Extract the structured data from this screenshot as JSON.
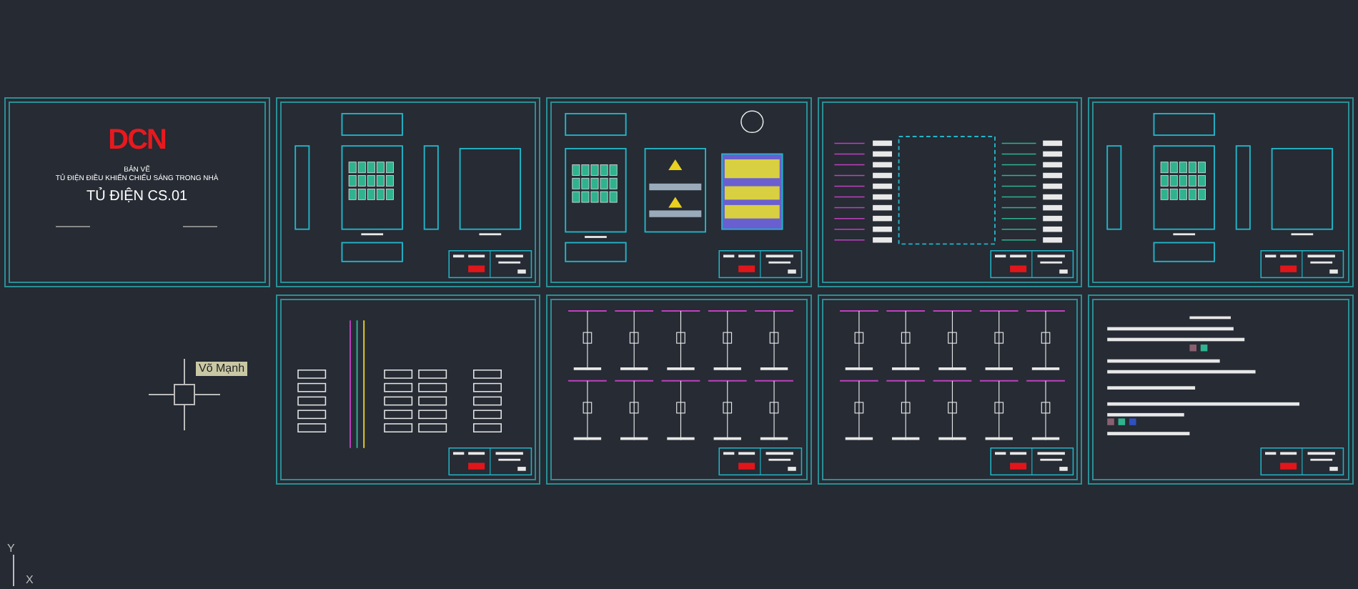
{
  "title_sheet": {
    "logo": "DCN",
    "caption": "BẢN VẼ",
    "subtitle": "TỦ ĐIỆN ĐIỀU KHIỂN CHIẾU SÁNG TRONG NHÀ",
    "title": "TỦ ĐIỆN CS.01"
  },
  "sheets": [
    {
      "kind": "enclosure"
    },
    {
      "kind": "assembly"
    },
    {
      "kind": "wiring"
    },
    {
      "kind": "enclosure"
    },
    {
      "kind": "schematic"
    },
    {
      "kind": "circuits"
    },
    {
      "kind": "circuits"
    },
    {
      "kind": "legend"
    }
  ],
  "cursor": {
    "tooltip": "Võ Mạnh"
  },
  "ucs": {
    "y_label": "Y",
    "x_label": "X"
  }
}
